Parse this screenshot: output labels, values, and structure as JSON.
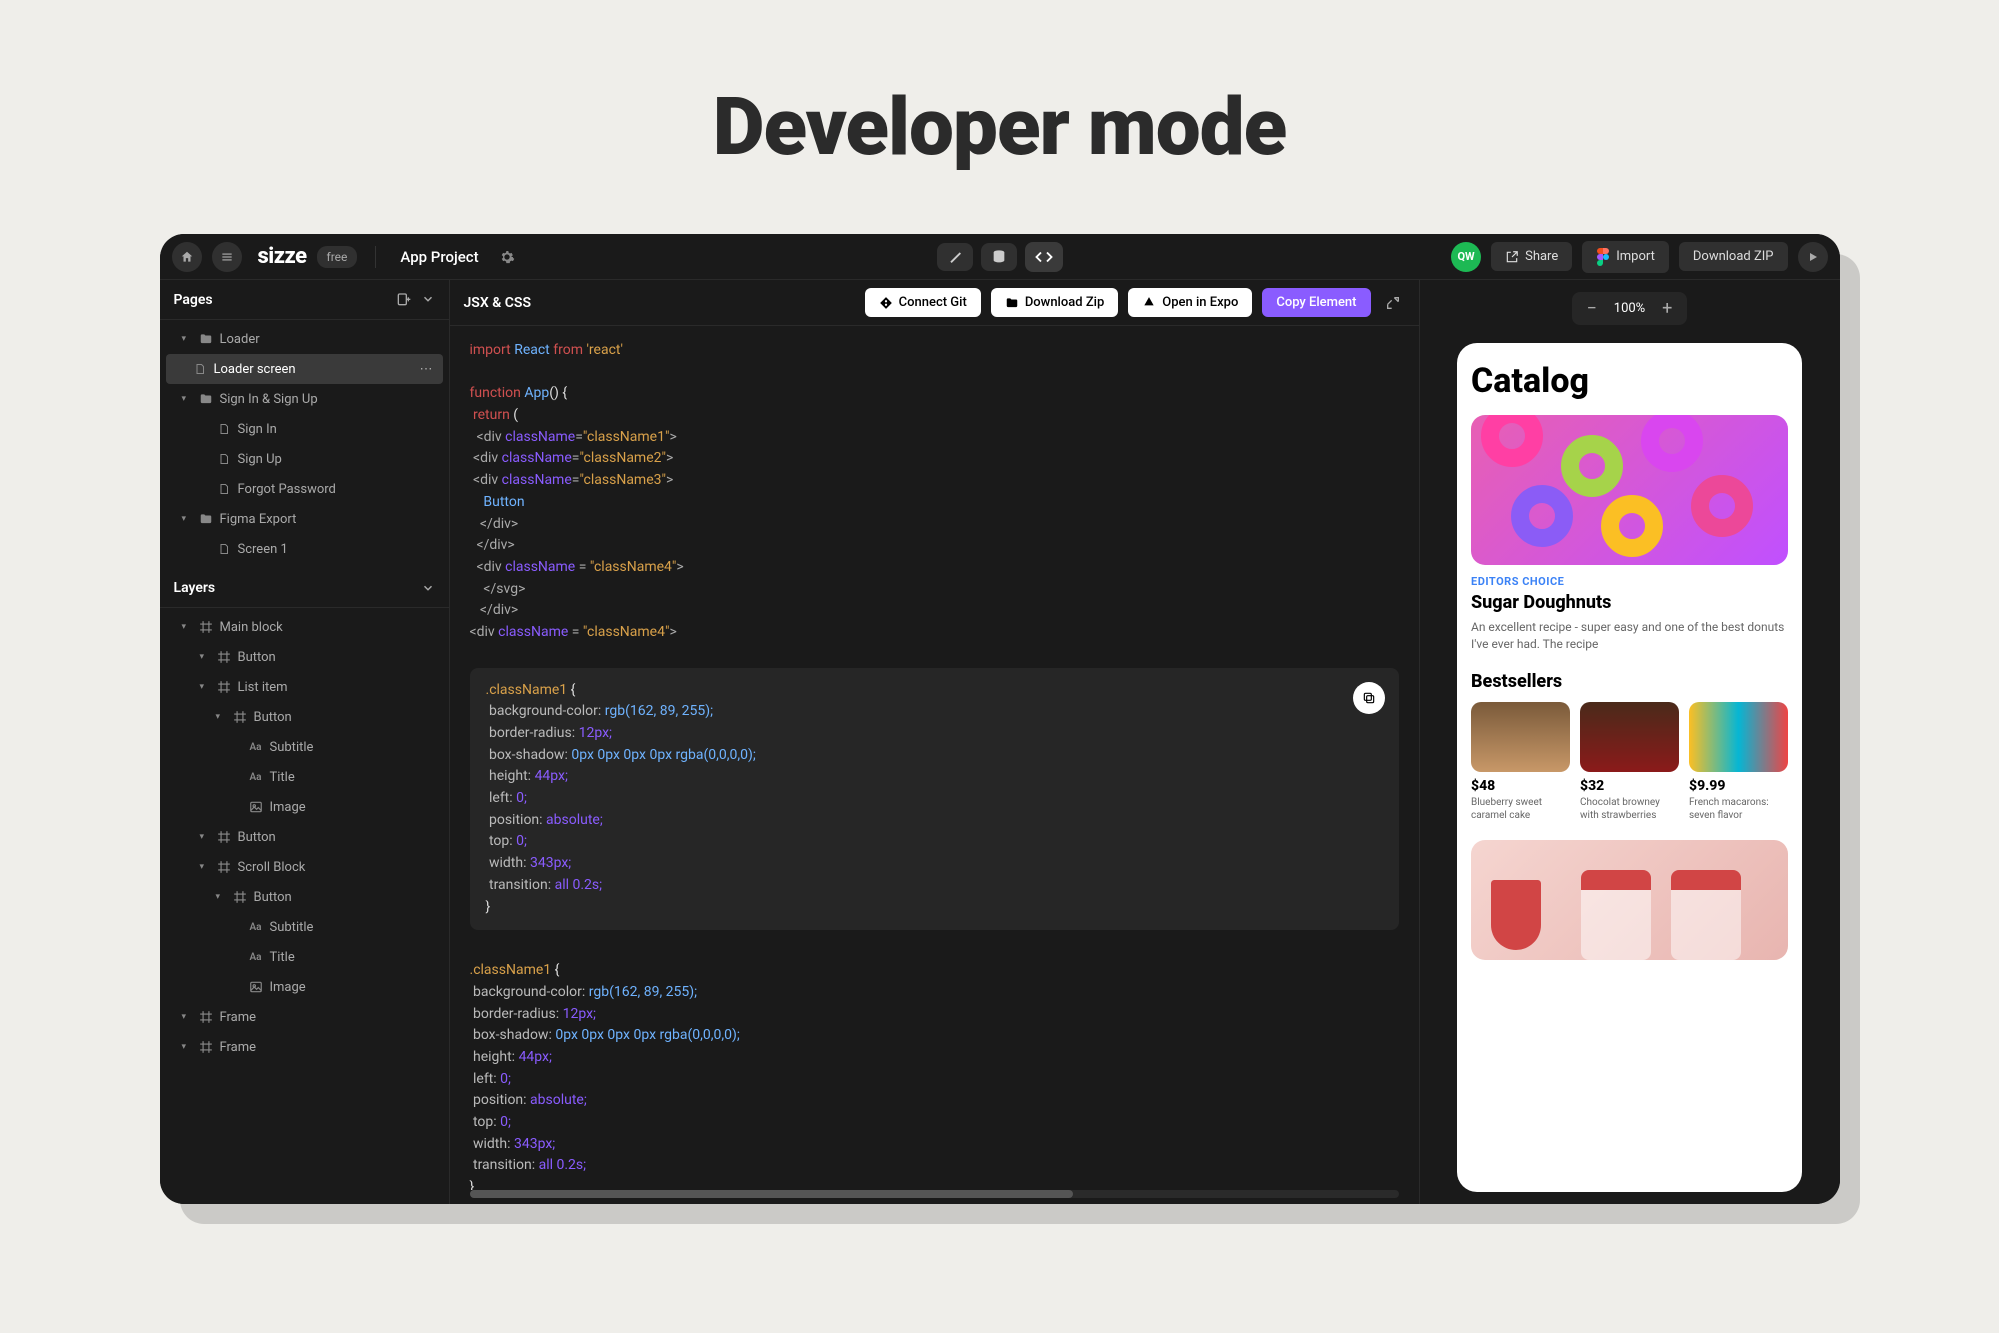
{
  "hero": "Developer mode",
  "brand": "sizze",
  "free_badge": "free",
  "project_title": "App Project",
  "avatar": "QW",
  "share": "Share",
  "import": "Import",
  "download_zip": "Download ZIP",
  "pages_header": "Pages",
  "layers_header": "Layers",
  "pages_tree": [
    {
      "label": "Loader",
      "kind": "folder",
      "indent": 1,
      "caret": true
    },
    {
      "label": "Loader screen",
      "kind": "file",
      "indent": 2,
      "selected": true
    },
    {
      "label": "Sign In & Sign Up",
      "kind": "folder",
      "indent": 1,
      "caret": true
    },
    {
      "label": "Sign In",
      "kind": "file",
      "indent": 2
    },
    {
      "label": "Sign Up",
      "kind": "file",
      "indent": 2
    },
    {
      "label": "Forgot Password",
      "kind": "file",
      "indent": 2
    },
    {
      "label": "Figma Export",
      "kind": "folder",
      "indent": 1,
      "caret": true
    },
    {
      "label": "Screen 1",
      "kind": "file",
      "indent": 2
    }
  ],
  "layers_tree": [
    {
      "label": "Main block",
      "kind": "frame",
      "indent": 1,
      "caret": true
    },
    {
      "label": "Button",
      "kind": "frame",
      "indent": 2,
      "caret": true
    },
    {
      "label": "List item",
      "kind": "frame",
      "indent": 2,
      "caret": true
    },
    {
      "label": "Button",
      "kind": "frame",
      "indent": 3,
      "caret": true
    },
    {
      "label": "Subtitle",
      "kind": "text",
      "indent": 4
    },
    {
      "label": "Title",
      "kind": "text",
      "indent": 4
    },
    {
      "label": "Image",
      "kind": "image",
      "indent": 4
    },
    {
      "label": "Button",
      "kind": "frame",
      "indent": 2,
      "caret": true
    },
    {
      "label": "Scroll Block",
      "kind": "frame",
      "indent": 2,
      "caret": true
    },
    {
      "label": "Button",
      "kind": "frame",
      "indent": 3,
      "caret": true
    },
    {
      "label": "Subtitle",
      "kind": "text",
      "indent": 4
    },
    {
      "label": "Title",
      "kind": "text",
      "indent": 4
    },
    {
      "label": "Image",
      "kind": "image",
      "indent": 4
    },
    {
      "label": "Frame",
      "kind": "frame",
      "indent": 1,
      "caret": true
    },
    {
      "label": "Frame",
      "kind": "frame",
      "indent": 1,
      "caret": true
    }
  ],
  "code_lang": "JSX & CSS",
  "connect_git": "Connect Git",
  "download_zip_btn": "Download Zip",
  "open_expo": "Open in Expo",
  "copy_element": "Copy Element",
  "zoom_level": "100%",
  "jsx": {
    "l1a": "import",
    "l1b": "React",
    "l1c": "from",
    "l1d": "'react'",
    "l3a": "function",
    "l3b": "App",
    "l3c": "() {",
    "l4a": "return",
    "l4b": "(",
    "attr": "className",
    "c1": "\"className1\"",
    "c2": "\"className2\"",
    "c3": "\"className3\"",
    "c4": "\"className4\"",
    "btn": "Button",
    "div_close": "</div>",
    "svg_close": "</svg>"
  },
  "css": {
    "selector": ".className1",
    "open": " {",
    "bg": "background-color:",
    "bg_val": "rgb(162, 89, 255);",
    "br": "border-radius:",
    "br_val": "12px;",
    "bs": "box-shadow:",
    "bs_val": "0px 0px 0px 0px rgba(0,0,0,0);",
    "h": "height:",
    "h_val": "44px;",
    "l": "left:",
    "l_val": "0;",
    "pos": "position:",
    "pos_val": "absolute;",
    "t": "top:",
    "t_val": "0;",
    "w": "width:",
    "w_val": "343px;",
    "tr": "transition:",
    "tr_val": "all 0.2s;",
    "close": "}"
  },
  "preview": {
    "catalog": "Catalog",
    "editors_choice": "EDITORS CHOICE",
    "hero_title": "Sugar Doughnuts",
    "hero_desc": "An excellent recipe - super easy and one of the best donuts I've ever had. The recipe",
    "bestsellers": "Bestsellers",
    "items": [
      {
        "price": "$48",
        "name": "Blueberry sweet caramel cake"
      },
      {
        "price": "$32",
        "name": "Chocolat browney with strawberries"
      },
      {
        "price": "$9.99",
        "name": "French macarons: seven flavor"
      }
    ]
  }
}
